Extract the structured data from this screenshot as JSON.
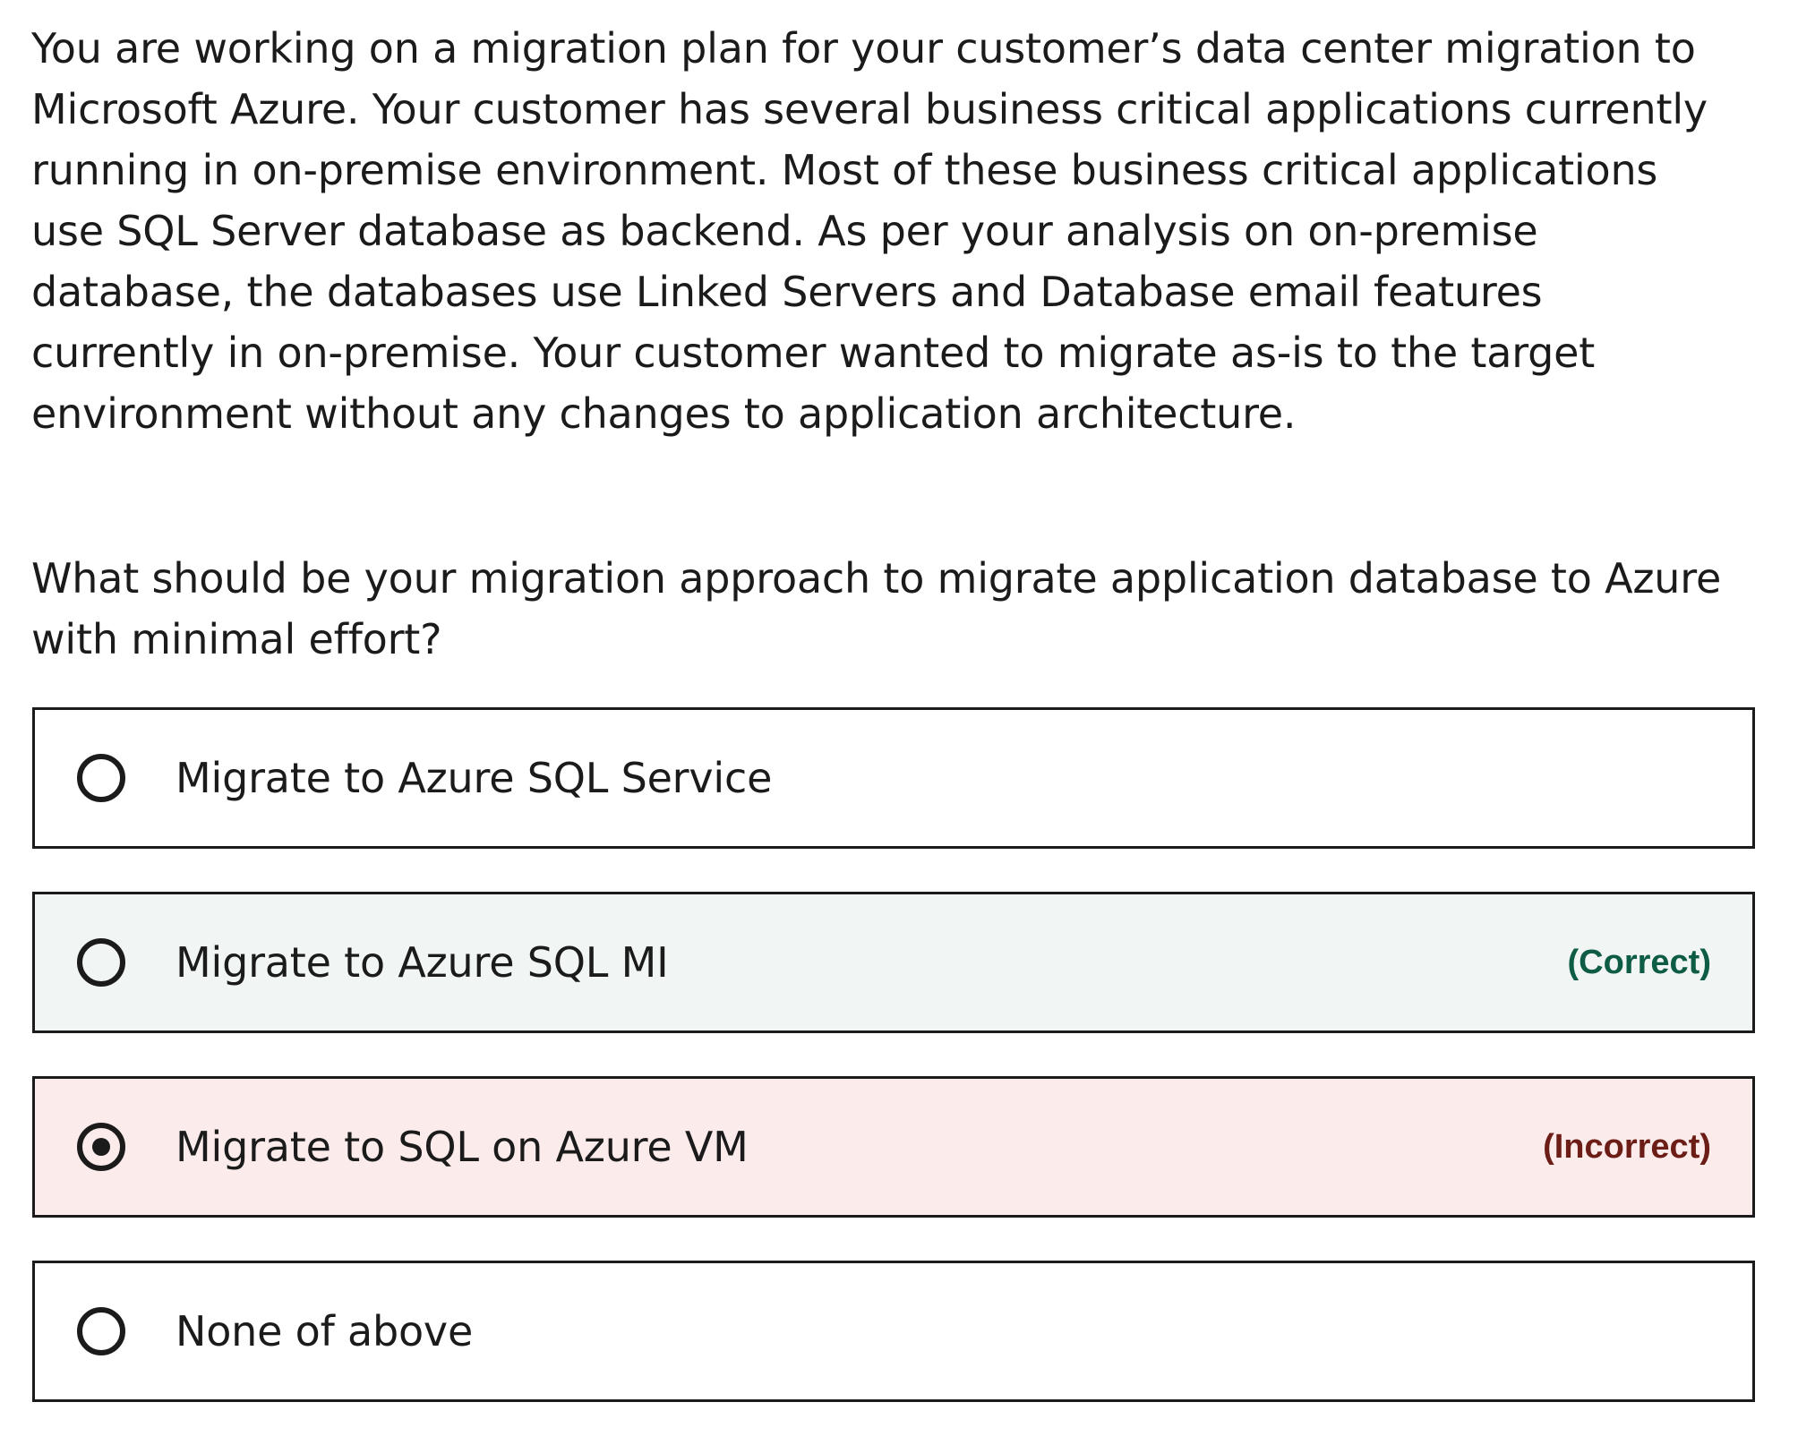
{
  "scenario": {
    "text": "You are working on a migration plan for your customer’s data center migration to Microsoft Azure. Your customer has several business critical applications currently running in on-premise environment. Most of these business critical applications use SQL Server database as backend. As per your analysis on on-premise database, the databases use Linked Servers and Database email features currently in on-premise. Your customer wanted to migrate as-is to the target environment without any changes to application architecture."
  },
  "question": {
    "text": "What should be your migration approach to migrate application database to Azure with minimal effort?"
  },
  "options": [
    {
      "label": "Migrate to Azure SQL Service",
      "selected": false,
      "result": ""
    },
    {
      "label": "Migrate to Azure SQL MI",
      "selected": false,
      "result": "(Correct)"
    },
    {
      "label": "Migrate to SQL on Azure VM",
      "selected": true,
      "result": "(Incorrect)"
    },
    {
      "label": "None of above",
      "selected": false,
      "result": ""
    }
  ],
  "colors": {
    "text": "#1b1b1b",
    "correct_background": "#f1f5f4",
    "incorrect_background": "#fbeceb",
    "correct_text": "#0e5c45",
    "incorrect_text": "#6b1d16"
  }
}
